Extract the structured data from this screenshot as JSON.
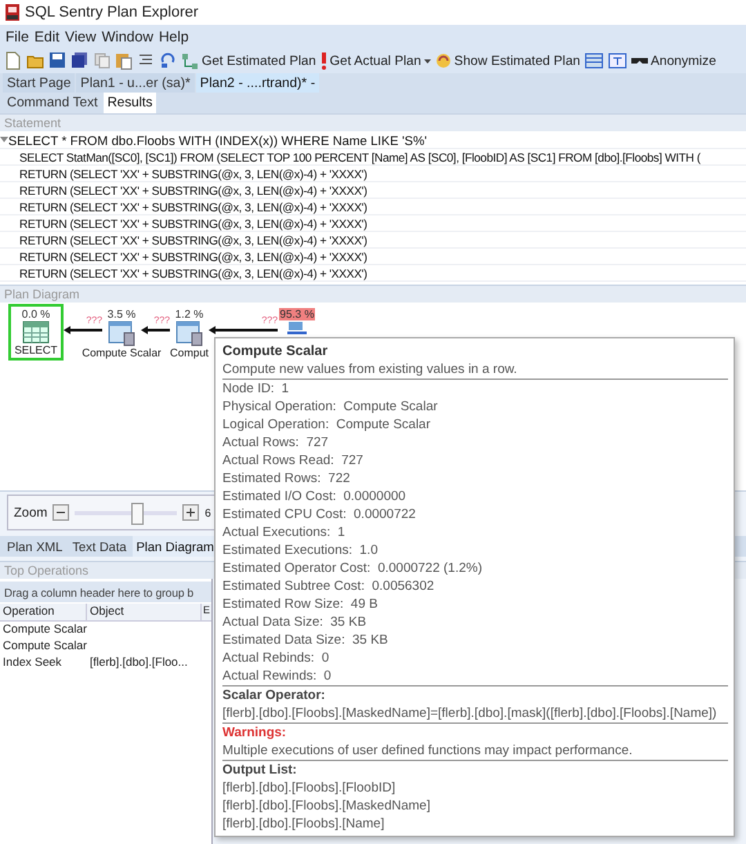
{
  "window": {
    "title": "SQL Sentry Plan Explorer"
  },
  "menu": [
    "File",
    "Edit",
    "View",
    "Window",
    "Help"
  ],
  "toolbar": [
    {
      "label": "Get Estimated Plan",
      "dropdown": false,
      "kind": "estimated"
    },
    {
      "label": "Get Actual Plan",
      "dropdown": true,
      "kind": "actual"
    },
    {
      "label": "Show Estimated Plan",
      "dropdown": false,
      "kind": "show"
    },
    {
      "label": "Anonymize",
      "dropdown": false,
      "kind": "anonymize"
    }
  ],
  "document_tabs": [
    {
      "label": "Start Page",
      "selected": false
    },
    {
      "label": "Plan1 - u...er (sa)*",
      "selected": false
    },
    {
      "label": "Plan2 - ....rtrand)* -",
      "selected": true
    }
  ],
  "result_tabs": [
    {
      "label": "Command Text",
      "selected": false
    },
    {
      "label": "Results",
      "selected": true
    }
  ],
  "statement": {
    "header": "Statement",
    "rows": [
      {
        "text": "SELECT * FROM dbo.Floobs WITH (INDEX(x)) WHERE Name LIKE 'S%'",
        "expanded": true,
        "children": [
          {
            "text": "SELECT StatMan([SC0], [SC1]) FROM (SELECT TOP 100 PERCENT [Name] AS [SC0], [FloobID] AS [SC1] FROM [dbo].[Floobs] WITH ("
          },
          {
            "text": "RETURN (SELECT 'XX' + SUBSTRING(@x, 3, LEN(@x)-4) + 'XXXX')"
          },
          {
            "text": "RETURN (SELECT 'XX' + SUBSTRING(@x, 3, LEN(@x)-4) + 'XXXX')"
          },
          {
            "text": "RETURN (SELECT 'XX' + SUBSTRING(@x, 3, LEN(@x)-4) + 'XXXX')"
          },
          {
            "text": "RETURN (SELECT 'XX' + SUBSTRING(@x, 3, LEN(@x)-4) + 'XXXX')"
          },
          {
            "text": "RETURN (SELECT 'XX' + SUBSTRING(@x, 3, LEN(@x)-4) + 'XXXX')"
          },
          {
            "text": "RETURN (SELECT 'XX' + SUBSTRING(@x, 3, LEN(@x)-4) + 'XXXX')"
          },
          {
            "text": "RETURN (SELECT 'XX' + SUBSTRING(@x, 3, LEN(@x)-4) + 'XXXX')"
          }
        ]
      }
    ]
  },
  "plan_diagram": {
    "header": "Plan Diagram",
    "nodes": [
      {
        "kind": "select",
        "label": "SELECT",
        "cost": "0.0 %",
        "high_cost": false,
        "selected": true
      },
      {
        "kind": "compute",
        "label": "Compute Scalar",
        "cost": "3.5 %",
        "high_cost": false,
        "selected": false,
        "rows": "???"
      },
      {
        "kind": "compute",
        "label": "Comput",
        "cost": "1.2 %",
        "high_cost": false,
        "selected": false,
        "rows": "???"
      },
      {
        "kind": "seek",
        "cost": "95.3 %",
        "high_cost": true,
        "selected": false,
        "rows": "???"
      }
    ],
    "zoom": {
      "label": "Zoom",
      "level": 0.6,
      "reading": "6"
    }
  },
  "view_tabs": [
    {
      "label": "Plan XML",
      "selected": false
    },
    {
      "label": "Text Data",
      "selected": false
    },
    {
      "label": "Plan Diagram",
      "selected": true
    }
  ],
  "top_operations": {
    "header": "Top Operations",
    "group_hint": "Drag a column header here to group b",
    "columns": [
      "Operation",
      "Object",
      "E"
    ],
    "rows": [
      [
        "Compute Scalar",
        ""
      ],
      [
        "Compute Scalar",
        ""
      ],
      [
        "Index Seek",
        "[flerb].[dbo].[Floo..."
      ]
    ]
  },
  "tooltip": {
    "title": "Compute Scalar",
    "description": "Compute new values from existing values in a row.",
    "properties": [
      {
        "label": "Node ID:",
        "value": "1"
      },
      {
        "label": "Physical Operation:",
        "value": "Compute Scalar"
      },
      {
        "label": "Logical Operation:",
        "value": "Compute Scalar"
      },
      {
        "label": "Actual Rows:",
        "value": "727"
      },
      {
        "label": "Actual Rows Read:",
        "value": "727"
      },
      {
        "label": "Estimated Rows:",
        "value": "722"
      },
      {
        "label": "Estimated I/O Cost:",
        "value": "0.0000000"
      },
      {
        "label": "Estimated CPU Cost:",
        "value": "0.0000722"
      },
      {
        "label": "Actual Executions:",
        "value": "1"
      },
      {
        "label": "Estimated Executions:",
        "value": "1.0"
      },
      {
        "label": "Estimated Operator Cost:",
        "value": "0.0000722 (1.2%)"
      },
      {
        "label": "Estimated Subtree Cost:",
        "value": "0.0056302"
      },
      {
        "label": "Estimated Row Size:",
        "value": "49 B"
      },
      {
        "label": "Actual Data Size:",
        "value": "35 KB"
      },
      {
        "label": "Estimated Data Size:",
        "value": "35 KB"
      },
      {
        "label": "Actual Rebinds:",
        "value": "0"
      },
      {
        "label": "Actual Rewinds:",
        "value": "0"
      }
    ],
    "sections": [
      {
        "heading": "Scalar Operator:",
        "kind": "normal",
        "lines": [
          "[flerb].[dbo].[Floobs].[MaskedName]=[flerb].[dbo].[mask]([flerb].[dbo].[Floobs].[Name])"
        ]
      },
      {
        "heading": "Warnings:",
        "kind": "warning",
        "lines": [
          "Multiple executions of user defined functions may impact performance."
        ]
      },
      {
        "heading": "Output List:",
        "kind": "normal",
        "lines": [
          "[flerb].[dbo].[Floobs].[FloobID]",
          "[flerb].[dbo].[Floobs].[MaskedName]",
          "[flerb].[dbo].[Floobs].[Name]"
        ]
      }
    ]
  }
}
